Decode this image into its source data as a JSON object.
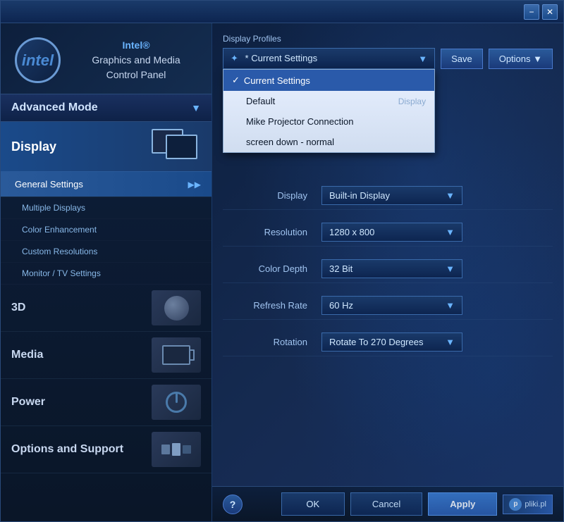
{
  "window": {
    "title": "Intel® Graphics and Media Control Panel",
    "title_bar_min": "−",
    "title_bar_close": "✕"
  },
  "sidebar": {
    "logo_text_line1": "Intel®",
    "logo_text_line2": "Graphics and Media",
    "logo_text_line3": "Control Panel",
    "logo_symbol": "intel",
    "advanced_mode_label": "Advanced Mode",
    "advanced_mode_arrow": "▼",
    "display_label": "Display",
    "nav_items": [
      {
        "label": "General Settings",
        "arrow": "▶▶",
        "active": true
      },
      {
        "label": "Multiple Displays"
      },
      {
        "label": "Color Enhancement"
      },
      {
        "label": "Custom Resolutions"
      },
      {
        "label": "Monitor / TV Settings"
      }
    ],
    "categories": [
      {
        "label": "3D"
      },
      {
        "label": "Media"
      },
      {
        "label": "Power"
      },
      {
        "label": "Options and Support"
      }
    ]
  },
  "right_panel": {
    "profiles_label": "Display Profiles",
    "profile_selected": "* Current Settings",
    "save_label": "Save",
    "options_label": "Options ▼",
    "dropdown_items": [
      {
        "label": "Current Settings",
        "selected": true,
        "check": "✓"
      },
      {
        "label": "Default",
        "selected": false,
        "check": ""
      },
      {
        "label": "Mike Projector Connection",
        "selected": false,
        "check": ""
      },
      {
        "label": "screen down - normal",
        "selected": false,
        "check": ""
      }
    ],
    "display_sub_label": "Display",
    "settings": [
      {
        "label": "Display",
        "value": "Built-in Display"
      },
      {
        "label": "Resolution",
        "value": "1280 x 800"
      },
      {
        "label": "Color Depth",
        "value": "32 Bit"
      },
      {
        "label": "Refresh Rate",
        "value": "60 Hz"
      },
      {
        "label": "Rotation",
        "value": "Rotate To 270 Degrees"
      }
    ]
  },
  "bottom": {
    "help_label": "?",
    "ok_label": "OK",
    "cancel_label": "Cancel",
    "apply_label": "Apply",
    "pliki_label": "pliki.pl"
  }
}
